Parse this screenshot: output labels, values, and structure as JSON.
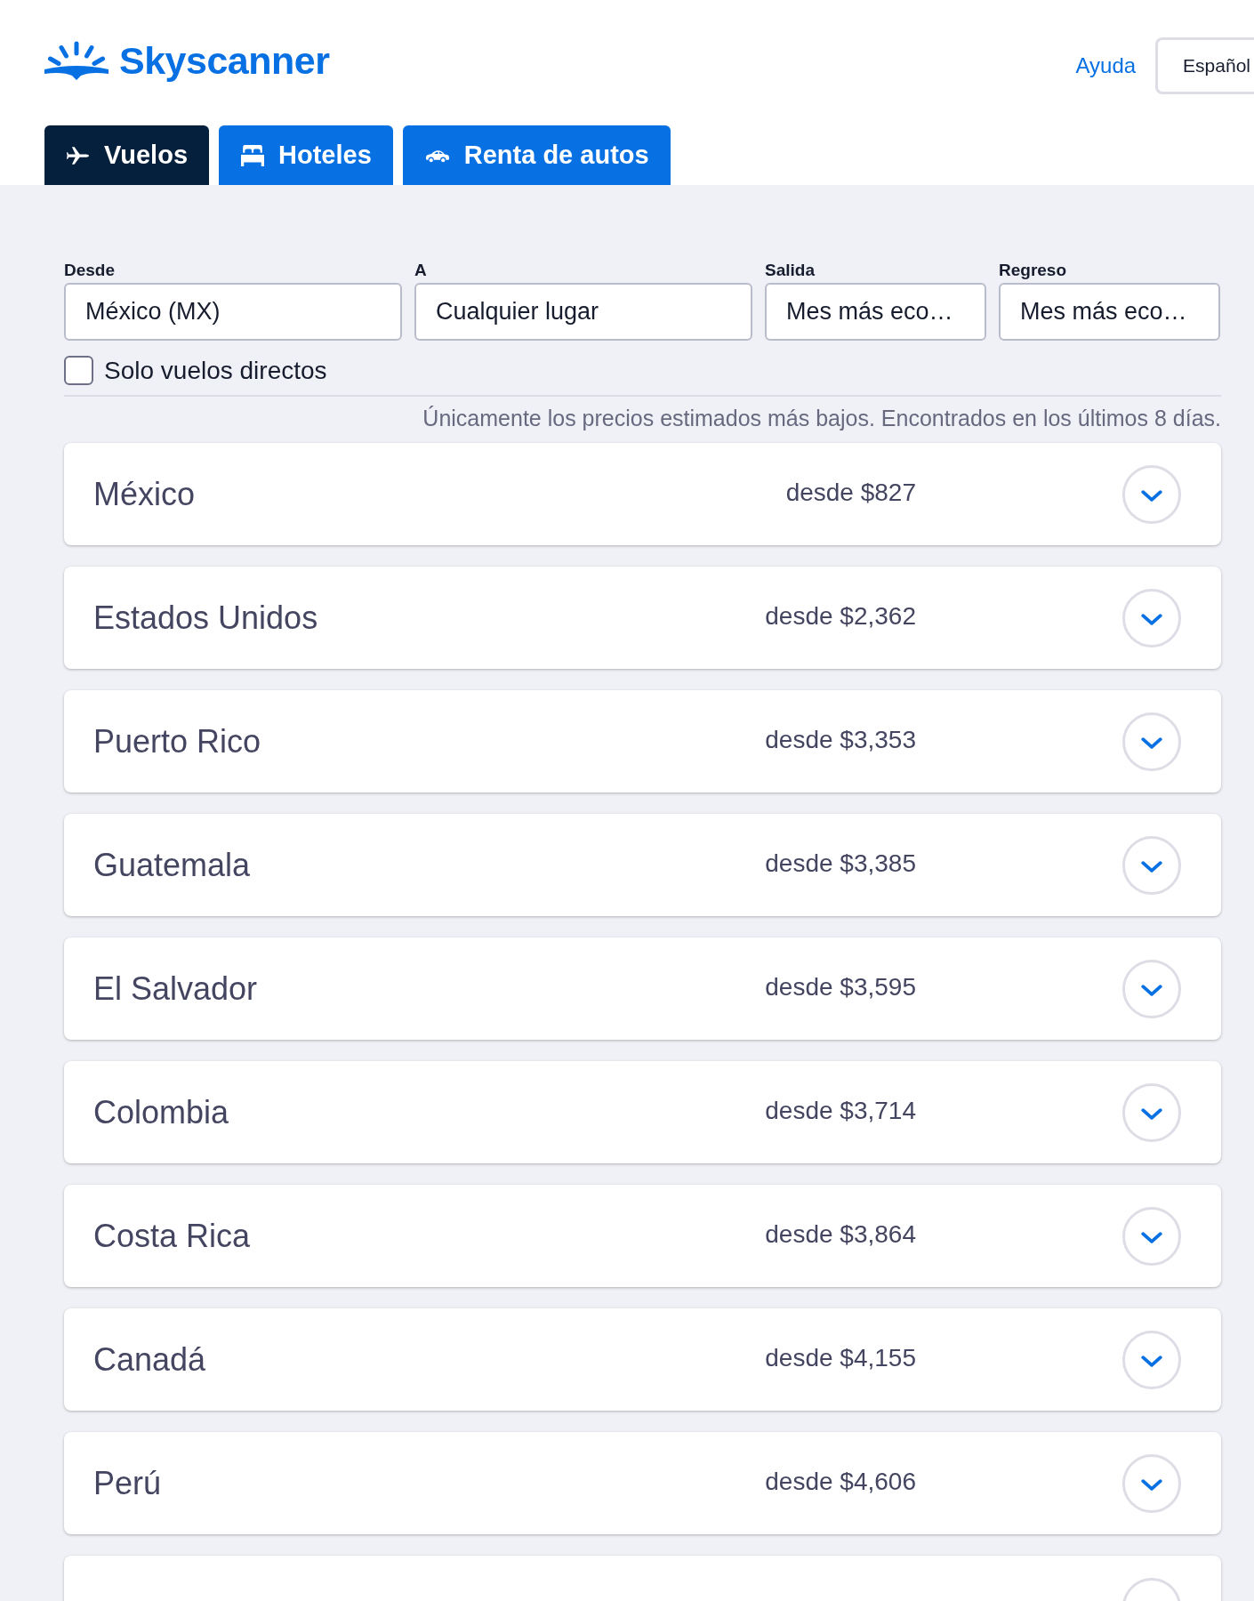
{
  "header": {
    "logo": "Skyscanner",
    "help_link": "Ayuda",
    "language_button": "Español"
  },
  "tabs": [
    {
      "label": "Vuelos",
      "kind": "flights",
      "selected": true
    },
    {
      "label": "Hoteles",
      "kind": "hotels",
      "selected": false
    },
    {
      "label": "Renta de autos",
      "kind": "cars",
      "selected": false
    }
  ],
  "search": {
    "fields": [
      {
        "label": "Desde",
        "value": "México (MX)"
      },
      {
        "label": "A",
        "value": "Cualquier lugar"
      },
      {
        "label": "Salida",
        "value": "Mes más eco…"
      },
      {
        "label": "Regreso",
        "value": "Mes más eco…"
      }
    ],
    "direct_only": {
      "label": "Solo vuelos directos",
      "checked": false
    },
    "note": "Únicamente los precios estimados más bajos. Encontrados en los últimos 8 días."
  },
  "results": [
    {
      "kind": "destination",
      "name": "México",
      "price": "desde $827",
      "expanded": false
    },
    {
      "kind": "destination",
      "name": "Estados Unidos",
      "price": "desde $2,362",
      "expanded": false
    },
    {
      "kind": "destination",
      "name": "Puerto Rico",
      "price": "desde $3,353",
      "expanded": false
    },
    {
      "kind": "destination",
      "name": "Guatemala",
      "price": "desde $3,385",
      "expanded": false
    },
    {
      "kind": "destination",
      "name": "El Salvador",
      "price": "desde $3,595",
      "expanded": false
    },
    {
      "kind": "destination",
      "name": "Colombia",
      "price": "desde $3,714",
      "expanded": false
    },
    {
      "kind": "destination",
      "name": "Costa Rica",
      "price": "desde $3,864",
      "expanded": false
    },
    {
      "kind": "destination",
      "name": "Canadá",
      "price": "desde $4,155",
      "expanded": false
    },
    {
      "kind": "destination",
      "name": "Perú",
      "price": "desde $4,606",
      "expanded": false
    },
    {
      "kind": "cut_off"
    }
  ]
}
